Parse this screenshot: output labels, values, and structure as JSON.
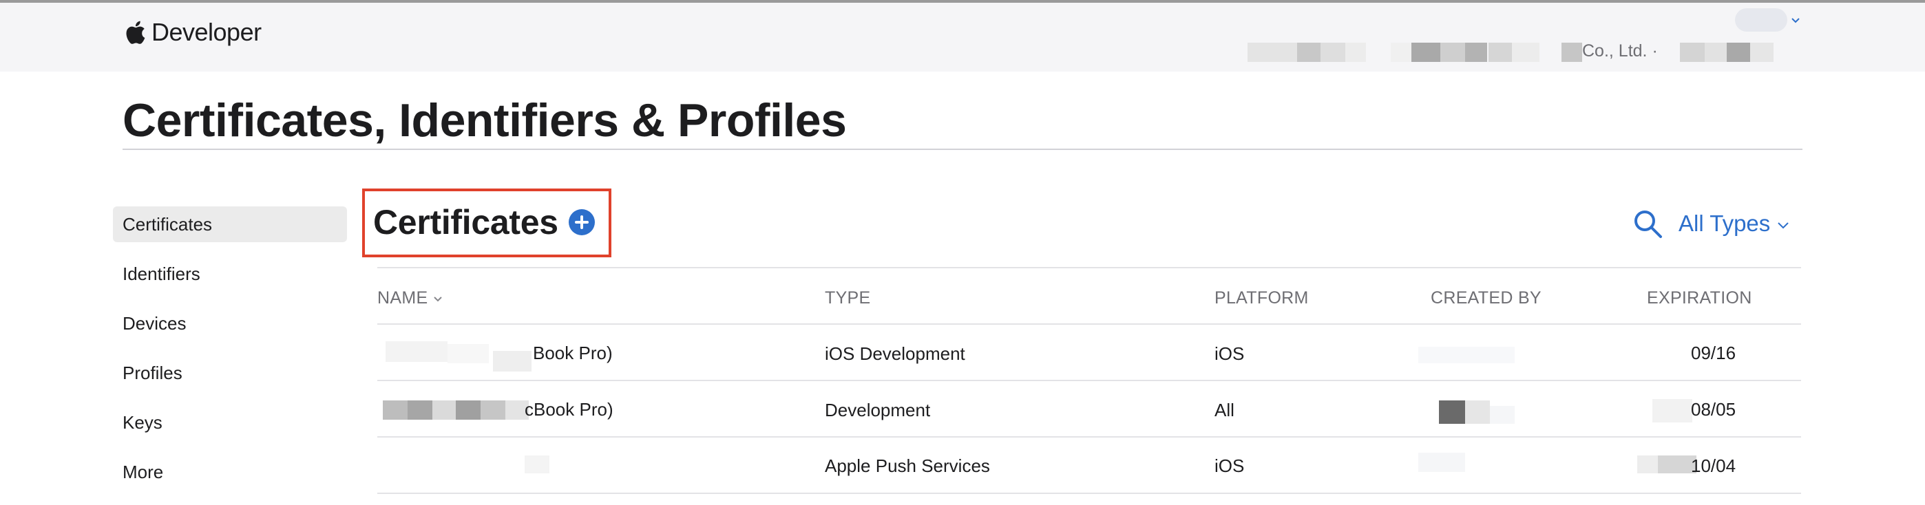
{
  "header": {
    "brand": "Developer",
    "account_info": "Co., Ltd. ·"
  },
  "page": {
    "title": "Certificates, Identifiers & Profiles"
  },
  "sidebar": {
    "items": [
      {
        "label": "Certificates"
      },
      {
        "label": "Identifiers"
      },
      {
        "label": "Devices"
      },
      {
        "label": "Profiles"
      },
      {
        "label": "Keys"
      },
      {
        "label": "More"
      }
    ]
  },
  "section": {
    "title": "Certificates",
    "filter_label": "All Types"
  },
  "table": {
    "headers": [
      "NAME",
      "TYPE",
      "PLATFORM",
      "CREATED BY",
      "EXPIRATION"
    ],
    "rows": [
      {
        "name": "Book Pro)",
        "type": "iOS Development",
        "platform": "iOS",
        "created_by": "",
        "expiration": "09/16"
      },
      {
        "name": "cBook Pro)",
        "type": "Development",
        "platform": "All",
        "created_by": "",
        "expiration": "08/05"
      },
      {
        "name": "",
        "type": "Apple Push Services",
        "platform": "iOS",
        "created_by": "",
        "expiration": "10/04"
      }
    ]
  },
  "colors": {
    "accent": "#2d6fcb",
    "highlight_border": "#e0422c",
    "header_bg": "#f5f5f7",
    "sidebar_active_bg": "#ebebeb"
  },
  "icons": [
    "apple-logo-icon",
    "chevron-down-icon",
    "plus-circle-icon",
    "search-icon",
    "sort-chevron-icon"
  ]
}
